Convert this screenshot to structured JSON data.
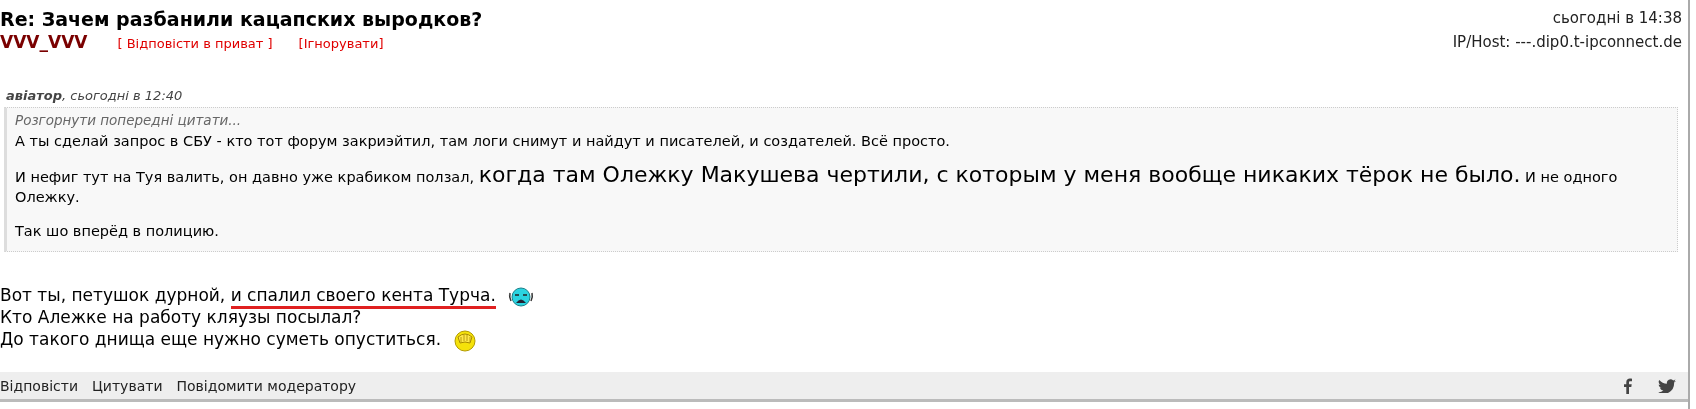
{
  "post": {
    "title": "Re: Зачем разбанили кацапских выродков?",
    "author": "VVV_VVV",
    "actions": [
      "[ Відповісти в приват ]",
      "[Ігнорувати]"
    ],
    "date": "сьогодні в 14:38",
    "host": "IP/Host: ---.dip0.t-ipconnect.de"
  },
  "quote": {
    "author": "авіатор",
    "date": ", сьогодні в 12:40",
    "expand": "Розгорнути попередні цитати...",
    "paragraphs": [
      [
        {
          "text": "А ты сделай запрос в СБУ - кто тот форум закриэйтил, там логи снимут и найдут и писателей, и создателей. Всё просто.",
          "large": false
        }
      ],
      [
        {
          "text": "И нефиг тут на Туя валить, он давно уже крабиком ползал, ",
          "large": false
        },
        {
          "text": "когда там Олежку Макушева чертили, с которым у меня вообще никаких тёрок не было.",
          "large": true
        },
        {
          "text": " И не одного Олежку.",
          "large": false
        }
      ],
      [
        {
          "text": "Так шо вперёд в полицию.",
          "large": false
        }
      ]
    ]
  },
  "message": [
    {
      "kind": "crying",
      "segments": [
        {
          "text": "Вот ты, петушок дурной, ",
          "underlined": false
        },
        {
          "text": "и спалил своего кента Турча.",
          "underlined": true
        }
      ]
    },
    {
      "kind": "plain",
      "segments": [
        {
          "text": "Кто Алежке на работу кляузы посылал?",
          "underlined": false
        }
      ]
    },
    {
      "kind": "facepalm",
      "segments": [
        {
          "text": "До такого днища еще нужно суметь опуститься.",
          "underlined": false
        }
      ]
    }
  ],
  "footer": {
    "links": [
      "Відповісти",
      "Цитувати",
      "Повідомити модератору"
    ],
    "share": [
      {
        "kind": "facebook"
      },
      {
        "kind": "twitter"
      }
    ]
  }
}
